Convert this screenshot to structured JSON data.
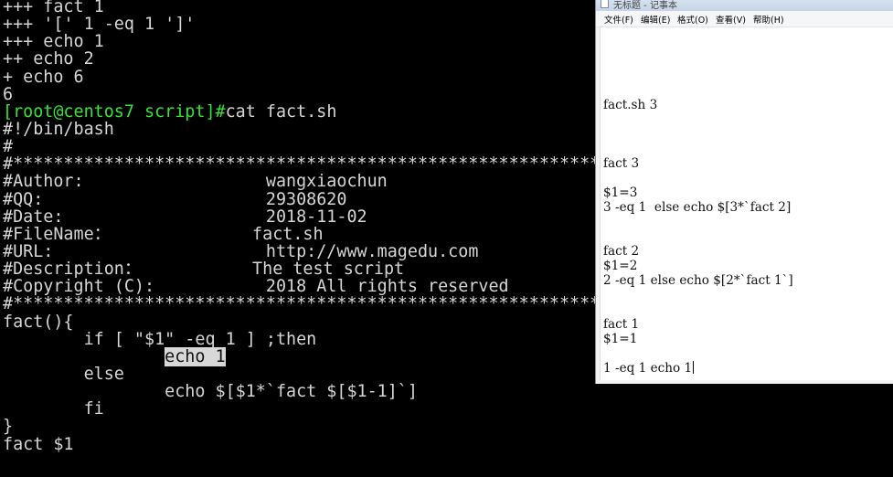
{
  "terminal": {
    "prompt": "[root@centos7 script]#",
    "command": "cat fact.sh",
    "trace_lines": [
      "+++ fact 1",
      "+++ '[' 1 -eq 1 ']'",
      "+++ echo 1",
      "++ echo 2",
      "+ echo 6",
      "6"
    ],
    "file_lines": [
      "#!/bin/bash",
      "#",
      "#*************************************************************************",
      "#Author:                  wangxiaochun",
      "#QQ:                      29308620",
      "#Date:                    2018-11-02",
      "#FileName：              fact.sh",
      "#URL:                     http://www.magedu.com",
      "#Description：           The test script",
      "#Copyright (C):           2018 All rights reserved",
      "#*************************************************************************",
      "fact(){",
      "        if [ \"$1\" -eq 1 ] ;then",
      "                ",
      "        else",
      "                echo $[$1*`fact $[$1-1]`]",
      "        fi",
      "}",
      "fact $1"
    ],
    "selected_text": "echo 1"
  },
  "notepad": {
    "title": "无标题 - 记事本",
    "menu": [
      "文件(F)",
      "编辑(E)",
      "格式(O)",
      "查看(V)",
      "帮助(H)"
    ],
    "lines": [
      "",
      "",
      "",
      "",
      "fact.sh 3",
      "",
      "",
      "",
      "fact 3",
      "",
      "$1=3",
      "3 -eq 1  else echo $[3*`fact 2]",
      "",
      "",
      "fact 2",
      "$1=2",
      "2 -eq 1 else echo $[2*`fact 1`]",
      "",
      "",
      "fact 1",
      "$1=1",
      "",
      "1 -eq 1 echo 1"
    ]
  },
  "colors": {
    "terminal_bg": "#000000",
    "terminal_text": "#d6d6d6",
    "prompt_green": "#34e334",
    "selection_bg": "#d8d8d8"
  }
}
